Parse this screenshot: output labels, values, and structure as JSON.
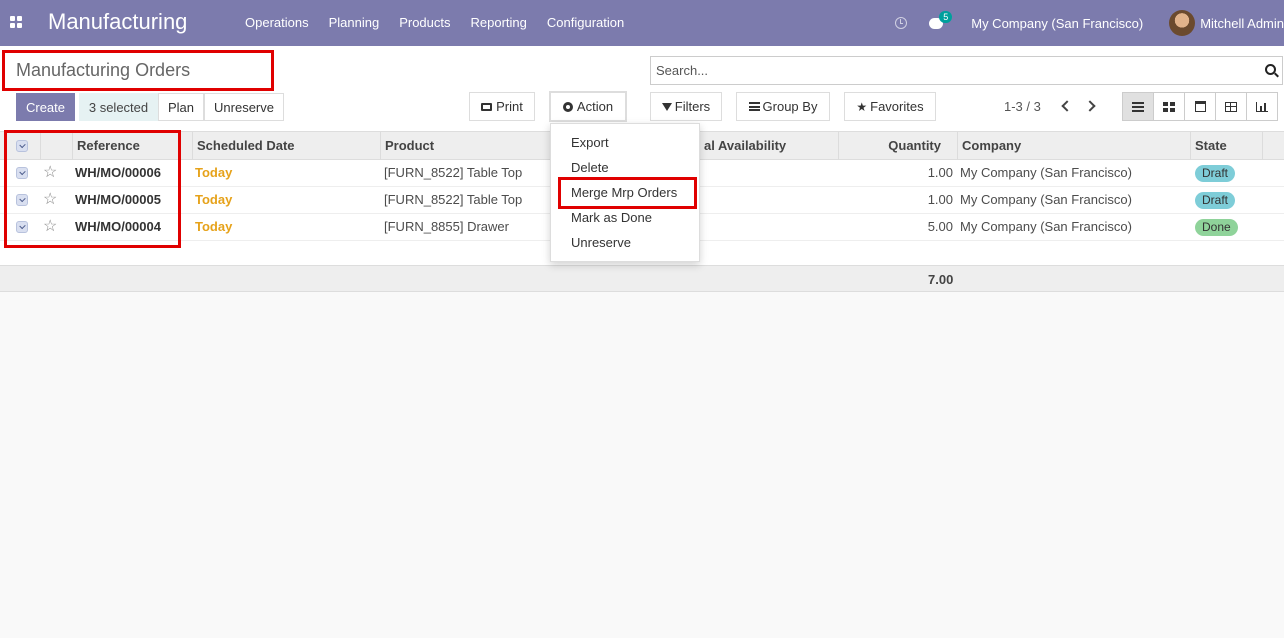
{
  "navbar": {
    "app_title": "Manufacturing",
    "menu": [
      "Operations",
      "Planning",
      "Products",
      "Reporting",
      "Configuration"
    ],
    "chat_badge": "5",
    "company": "My Company (San Francisco)",
    "user": "Mitchell Admin"
  },
  "control": {
    "title": "Manufacturing Orders",
    "search_placeholder": "Search...",
    "buttons": {
      "create": "Create",
      "selected": "3 selected",
      "plan": "Plan",
      "unreserve": "Unreserve",
      "print": "Print",
      "action": "Action",
      "filters": "Filters",
      "group_by": "Group By",
      "favorites": "Favorites"
    },
    "pager": "1-3 / 3"
  },
  "table": {
    "headers": {
      "reference": "Reference",
      "scheduled_date": "Scheduled Date",
      "product": "Product",
      "availability": "al Availability",
      "quantity": "Quantity",
      "company": "Company",
      "state": "State"
    },
    "rows": [
      {
        "reference": "WH/MO/00006",
        "date": "Today",
        "product": "[FURN_8522] Table Top",
        "quantity": "1.00",
        "company": "My Company (San Francisco)",
        "state": "Draft"
      },
      {
        "reference": "WH/MO/00005",
        "date": "Today",
        "product": "[FURN_8522] Table Top",
        "quantity": "1.00",
        "company": "My Company (San Francisco)",
        "state": "Draft"
      },
      {
        "reference": "WH/MO/00004",
        "date": "Today",
        "product": "[FURN_8855] Drawer",
        "quantity": "5.00",
        "company": "My Company (San Francisco)",
        "state": "Done"
      }
    ],
    "total_quantity": "7.00"
  },
  "action_menu": {
    "items": [
      "Export",
      "Delete",
      "Merge Mrp Orders",
      "Mark as Done",
      "Unreserve"
    ]
  },
  "colors": {
    "navbar": "#7c7bad",
    "highlight": "#e00000",
    "draft": "#7ecdd8",
    "done": "#8fd39a",
    "today": "#e6a21a"
  }
}
